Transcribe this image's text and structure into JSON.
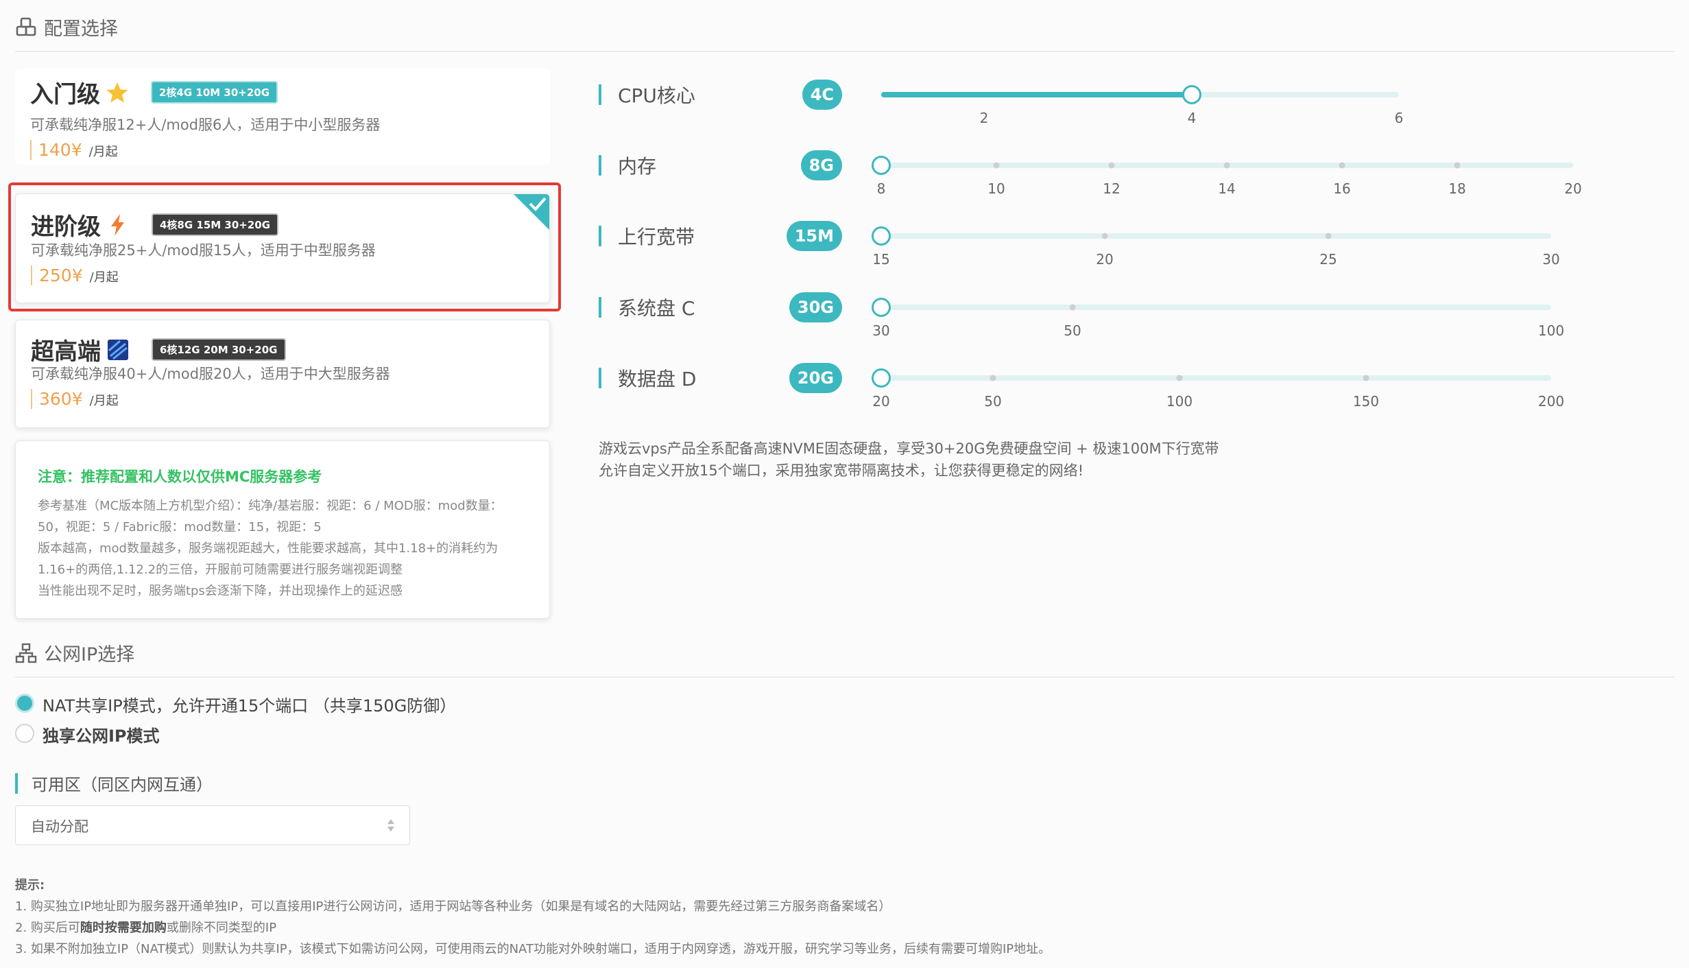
{
  "config_section": {
    "title": "配置选择",
    "icon": "cubes-icon"
  },
  "plans": [
    {
      "name": "入门级",
      "icon": "star-icon",
      "spec": "2核4G 10M 30+20G",
      "desc": "可承载纯净服12+人/mod服6人，适用于中小型服务器",
      "price": "140¥",
      "unit": "/月起"
    },
    {
      "name": "进阶级",
      "icon": "lightning-icon",
      "spec": "4核8G 15M 30+20G",
      "desc": "可承载纯净服25+人/mod服15人，适用于中型服务器",
      "price": "250¥",
      "unit": "/月起",
      "selected": true
    },
    {
      "name": "超高端",
      "icon": "chip-icon",
      "spec": "6核12G 20M 30+20G",
      "desc": "可承载纯净服40+人/mod服20人，适用于中大型服务器",
      "price": "360¥",
      "unit": "/月起"
    }
  ],
  "note": {
    "title": "注意：推荐配置和人数以仅供MC服务器参考",
    "lines": [
      "参考基准（MC版本随上方机型介绍）：纯净/基岩服：视距：6 / MOD服：mod数量：",
      "50，视距：5 / Fabric服：mod数量：15，视距：5",
      "版本越高，mod数量越多，服务端视距越大，性能要求越高，其中1.18+的消耗约为",
      "1.16+的两倍,1.12.2的三倍，开服前可随需要进行服务端视距调整",
      "当性能出现不足时，服务端tps会逐渐下降，并出现操作上的延迟感"
    ]
  },
  "sliders": [
    {
      "label": "CPU核心",
      "value": "4C",
      "level": 4,
      "ticks": [
        "2",
        "4",
        "6"
      ]
    },
    {
      "label": "内存",
      "value": "8G",
      "level": 8,
      "ticks": [
        "8",
        "10",
        "12",
        "14",
        "16",
        "18",
        "20"
      ]
    },
    {
      "label": "上行宽带",
      "value": "15M",
      "level": 15,
      "ticks": [
        "15",
        "20",
        "25",
        "30"
      ]
    },
    {
      "label": "系统盘 C",
      "value": "30G",
      "level": 30,
      "ticks": [
        "30",
        "50",
        "100"
      ]
    },
    {
      "label": "数据盘 D",
      "value": "20G",
      "level": 20,
      "ticks": [
        "20",
        "50",
        "100",
        "150",
        "200"
      ]
    }
  ],
  "info": [
    "游戏云vps产品全系配备高速NVME固态硬盘，享受30+20G免费硬盘空间 + 极速100M下行宽带",
    "允许自定义开放15个端口，采用独家宽带隔离技术，让您获得更稳定的网络!"
  ],
  "ip_section": {
    "title": "公网IP选择",
    "icon": "network-icon",
    "options": [
      {
        "label": "NAT共享IP模式，允许开通15个端口 （共享150G防御）",
        "checked": true
      },
      {
        "label": "独享公网IP模式",
        "checked": false
      }
    ]
  },
  "zone": {
    "label": "可用区（同区内网互通）",
    "value": "自动分配"
  },
  "tips": {
    "title": "提示:",
    "lines": [
      "1. 购买独立IP地址即为服务器开通单独IP，可以直接用IP进行公网访问，适用于网站等各种业务（如果是有域名的大陆网站，需要先经过第三方服务商备案域名）",
      "3. 如果不附加独立IP（NAT模式）则默认为共享IP，该模式下如需访问公网，可使用雨云的NAT功能对外映射端口，适用于内网穿透，游戏开服，研究学习等业务，后续有需要可增购IP地址。"
    ],
    "line2": {
      "prefix": "2. 购买后可",
      "bold": "随时按需要加购",
      "suffix": "或删除不同类型的IP"
    }
  },
  "colors": {
    "accent": "#3cb8c0",
    "price": "#f0a04b",
    "selected_border": "#e53935",
    "note_title": "#34c263"
  }
}
